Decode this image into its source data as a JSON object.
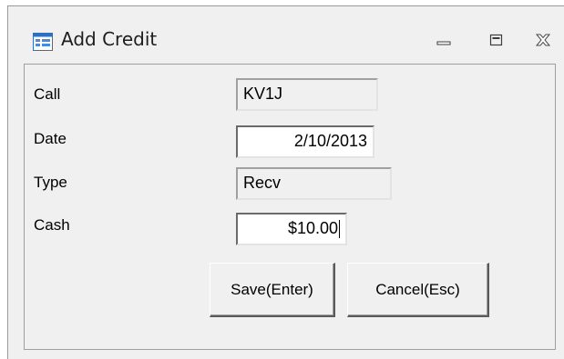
{
  "window": {
    "title": "Add Credit"
  },
  "controls": {
    "minimize_icon": "minimize-icon",
    "maximize_icon": "maximize-icon",
    "close_icon": "close-icon"
  },
  "form": {
    "fields": [
      {
        "label": "Call",
        "value": "KV1J",
        "editable": false
      },
      {
        "label": "Date",
        "value": "2/10/2013",
        "editable": true
      },
      {
        "label": "Type",
        "value": "Recv",
        "editable": false
      },
      {
        "label": "Cash",
        "value": "$10.00",
        "editable": true
      }
    ],
    "save_label": "Save(Enter)",
    "cancel_label": "Cancel(Esc)"
  },
  "colors": {
    "window_bg": "#f0f0f0",
    "icon_blue": "#2f6fbf"
  }
}
